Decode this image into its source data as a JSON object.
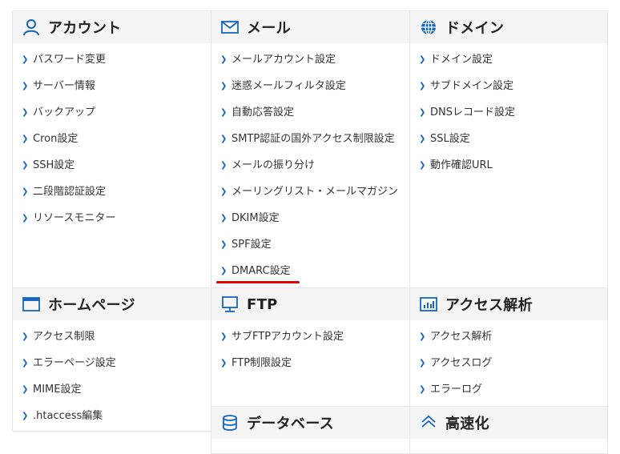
{
  "sections": {
    "account": {
      "title": "アカウント",
      "items": [
        "パスワード変更",
        "サーバー情報",
        "バックアップ",
        "Cron設定",
        "SSH設定",
        "二段階認証設定",
        "リソースモニター"
      ]
    },
    "mail": {
      "title": "メール",
      "items": [
        "メールアカウント設定",
        "迷惑メールフィルタ設定",
        "自動応答設定",
        "SMTP認証の国外アクセス制限設定",
        "メールの振り分け",
        "メーリングリスト・メールマガジン",
        "DKIM設定",
        "SPF設定",
        "DMARC設定"
      ]
    },
    "domain": {
      "title": "ドメイン",
      "items": [
        "ドメイン設定",
        "サブドメイン設定",
        "DNSレコード設定",
        "SSL設定",
        "動作確認URL"
      ]
    },
    "homepage": {
      "title": "ホームページ",
      "items": [
        "アクセス制限",
        "エラーページ設定",
        "MIME設定",
        ".htaccess編集"
      ]
    },
    "ftp": {
      "title": "FTP",
      "items": [
        "サブFTPアカウント設定",
        "FTP制限設定"
      ]
    },
    "analytics": {
      "title": "アクセス解析",
      "items": [
        "アクセス解析",
        "アクセスログ",
        "エラーログ"
      ]
    },
    "database": {
      "title": "データベース"
    },
    "speed": {
      "title": "高速化"
    }
  },
  "colors": {
    "icon": "#1565c0",
    "highlight": "#e00000",
    "header_bg": "#f5f5f5"
  },
  "icons": {
    "account": "user-icon",
    "mail": "envelope-icon",
    "domain": "globe-icon",
    "homepage": "browser-window-icon",
    "ftp": "monitor-icon",
    "analytics": "bar-chart-icon",
    "database": "database-icon",
    "speed": "speed-icon"
  }
}
